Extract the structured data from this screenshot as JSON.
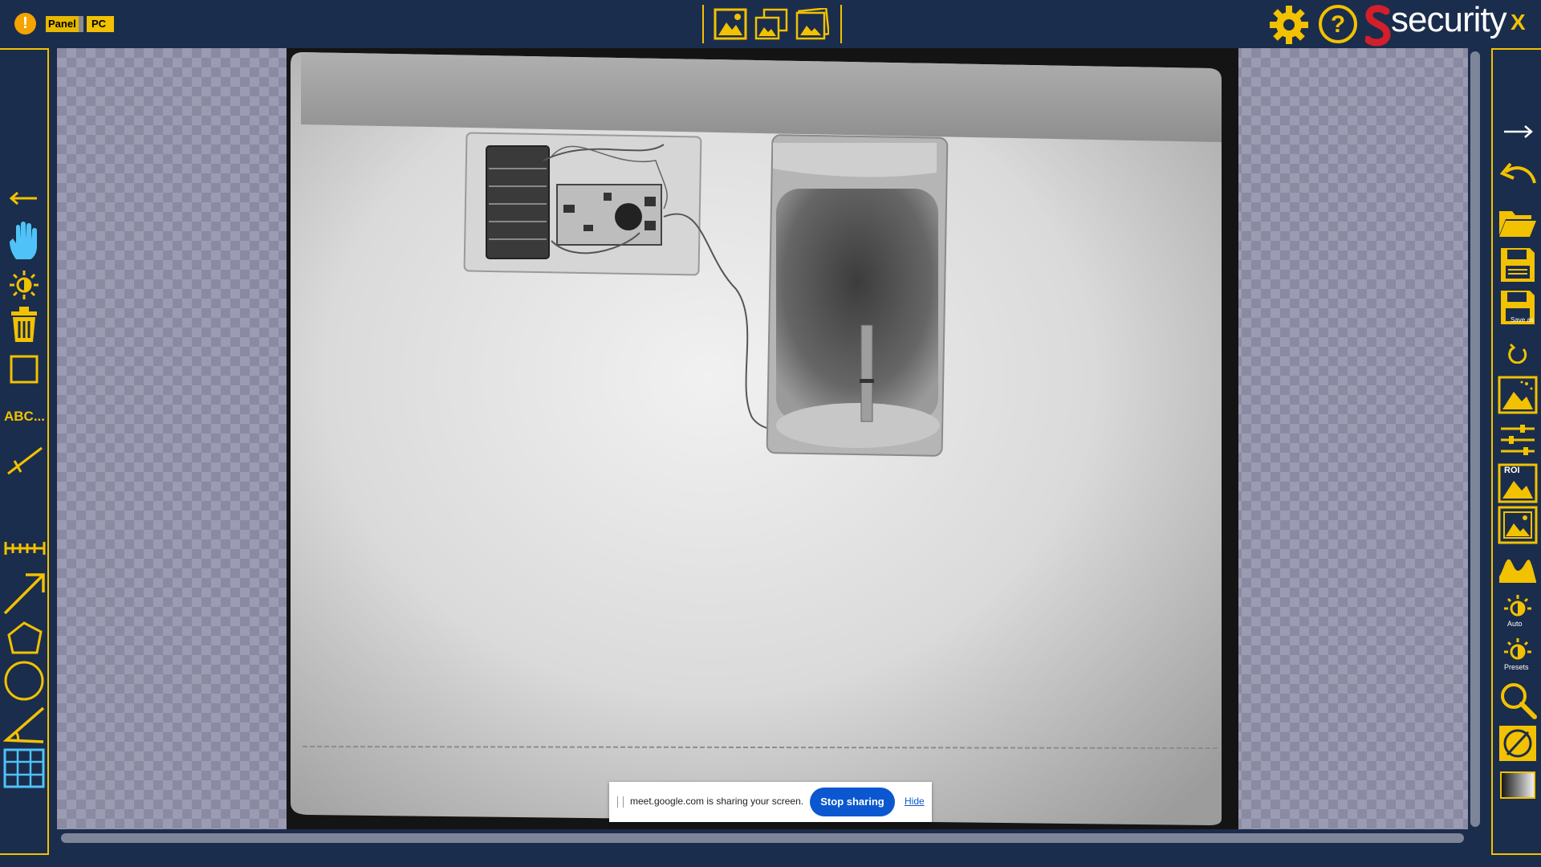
{
  "header": {
    "warning_glyph": "!",
    "badge_panel": "Panel",
    "badge_pc": "PC",
    "logo_text": "security",
    "close_label": "X",
    "image_view_icons": [
      "image-icon",
      "images-compare-icon",
      "image-stack-icon"
    ]
  },
  "left_toolbar": {
    "text_tool_label": "ABC...",
    "tools": [
      "back-arrow-icon",
      "hand-pan-icon",
      "brightness-icon",
      "trash-icon",
      "rectangle-icon",
      "text-tool",
      "line-measure-icon",
      "ruler-icon",
      "arrow-draw-icon",
      "polygon-icon",
      "ellipse-icon",
      "angle-icon",
      "grid-icon"
    ]
  },
  "right_toolbar": {
    "save_as_label": "Save as",
    "roi_label": "ROI",
    "auto_label": "Auto",
    "presets_label": "Presets",
    "tools": [
      "forward-arrow-icon",
      "undo-icon",
      "open-folder-icon",
      "save-icon",
      "save-as-icon",
      "rotate-icon",
      "image-enhance-icon",
      "sliders-icon",
      "roi-icon",
      "image-frame-icon",
      "histogram-icon",
      "auto-brightness-icon",
      "presets-brightness-icon",
      "zoom-icon",
      "invert-icon",
      "gradient-icon"
    ]
  },
  "screen_share": {
    "message": "meet.google.com is sharing your screen.",
    "stop_label": "Stop sharing",
    "hide_label": "Hide"
  },
  "colors": {
    "background": "#1b2d4c",
    "accent": "#f2c100",
    "tool_active": "#4fc3f7",
    "share_button": "#0b57d0"
  }
}
